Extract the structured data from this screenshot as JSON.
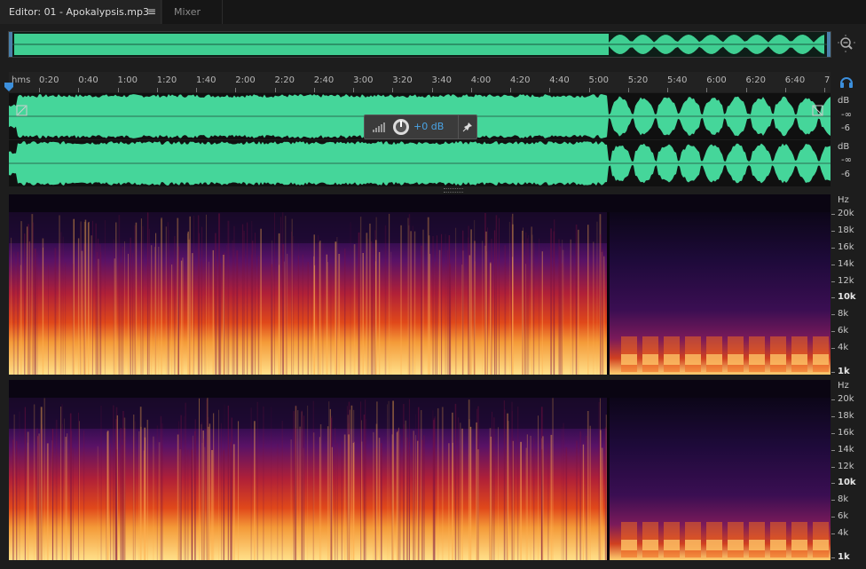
{
  "tabs": {
    "editor": "Editor: 01 - Apokalypsis.mp3",
    "menu_icon": "≡",
    "mixer": "Mixer"
  },
  "ruler": {
    "unit": "hms",
    "labels": [
      "0:20",
      "0:40",
      "1:00",
      "1:20",
      "1:40",
      "2:00",
      "2:20",
      "2:40",
      "3:00",
      "3:20",
      "3:40",
      "4:00",
      "4:20",
      "4:40",
      "5:00",
      "5:20",
      "5:40",
      "6:00",
      "6:20",
      "6:40",
      "7"
    ]
  },
  "channels": [
    {
      "db_unit": "dB",
      "db_marks": [
        "-∞",
        "-6"
      ]
    },
    {
      "db_unit": "dB",
      "db_marks": [
        "-∞",
        "-6"
      ]
    }
  ],
  "hud": {
    "gain": "+0 dB",
    "pin_icon": "pin-icon",
    "knob_icon": "volume-knob-icon"
  },
  "spectral": {
    "unit": "Hz",
    "freq_labels": [
      "20k",
      "18k",
      "16k",
      "14k",
      "12k",
      "10k",
      "8k",
      "6k",
      "4k",
      "1k"
    ],
    "bold_labels": [
      "10k",
      "1k"
    ]
  },
  "colors": {
    "waveform": "#45d69a",
    "accent": "#4aa4e6",
    "playhead": "#3c8fdc"
  }
}
